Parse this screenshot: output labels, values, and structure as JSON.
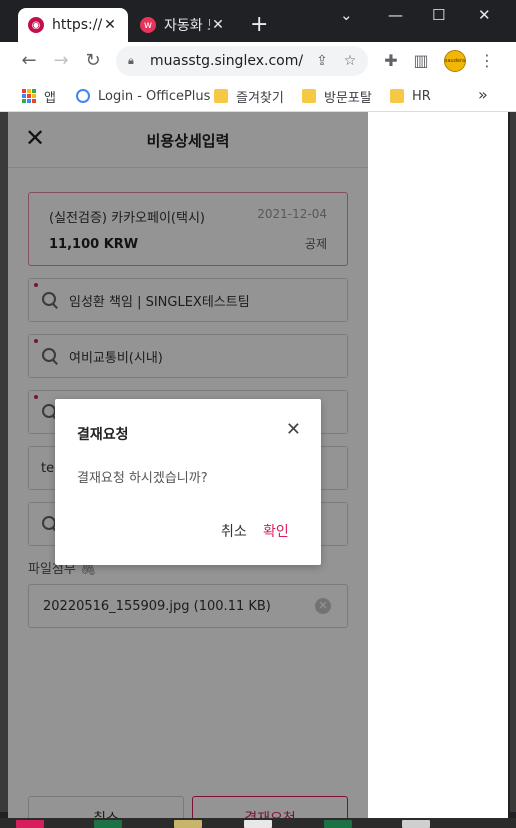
{
  "browser": {
    "tabs": [
      {
        "title": "https://m",
        "active": true,
        "favicon": "lg-logo-icon"
      },
      {
        "title": "자동화 토",
        "active": false,
        "favicon": "w-logo-icon"
      }
    ],
    "url": "muasstg.singlex.com/...",
    "bookmarks": [
      {
        "label": "앱",
        "icon": "apps-grid-icon"
      },
      {
        "label": "Login - OfficePlus",
        "icon": "globe-icon"
      },
      {
        "label": "즐겨찾기",
        "icon": "folder-icon"
      },
      {
        "label": "방문포탈",
        "icon": "folder-icon"
      },
      {
        "label": "HR",
        "icon": "folder-icon"
      }
    ],
    "avatar_text": "saudera"
  },
  "app": {
    "header_title": "비용상세입력",
    "expense": {
      "name": "(실전검증) 카카오페이(택시)",
      "date": "2021-12-04",
      "amount": "11,100 KRW",
      "tag": "공제"
    },
    "fields": [
      {
        "value": "임성환 책임 | SINGLEX테스트팀",
        "required": true,
        "icon": "search-icon"
      },
      {
        "value": "여비교통비(시내)",
        "required": true,
        "icon": "search-icon"
      },
      {
        "value": "",
        "required": true,
        "icon": "search-icon"
      },
      {
        "value": "te",
        "required": false,
        "icon": ""
      },
      {
        "value": "",
        "required": false,
        "icon": "search-icon"
      }
    ],
    "attach_label": "파일첨부",
    "file_name": "20220516_155909.jpg (100.11 KB)",
    "cancel_label": "취소",
    "approve_label": "결재요청"
  },
  "dialog": {
    "title": "결재요청",
    "message": "결재요청 하시겠습니까?",
    "cancel": "취소",
    "confirm": "확인"
  },
  "colors": {
    "accent": "#d61f5c",
    "card_border": "#e08aa2"
  }
}
